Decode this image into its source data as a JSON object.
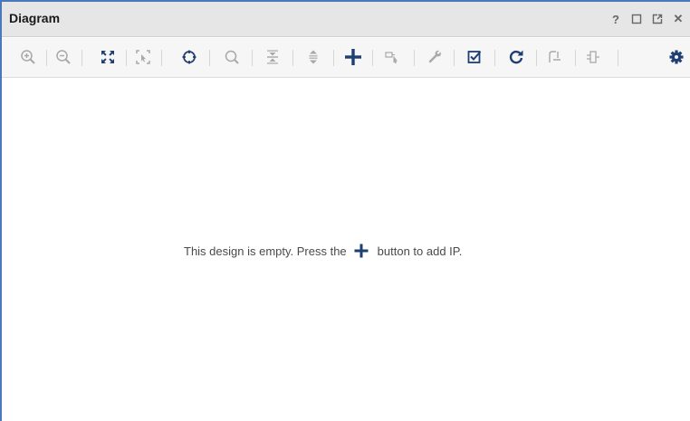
{
  "window": {
    "title": "Diagram",
    "controls": [
      {
        "name": "help",
        "icon": "question-icon",
        "glyph": "?"
      },
      {
        "name": "maximize",
        "icon": "maximize-icon"
      },
      {
        "name": "float",
        "icon": "float-window-icon"
      },
      {
        "name": "close",
        "icon": "close-icon",
        "glyph": "✕"
      }
    ]
  },
  "toolbar": {
    "buttons": [
      {
        "name": "zoom-in",
        "icon": "zoom-in-icon",
        "enabled": false
      },
      {
        "name": "zoom-out",
        "icon": "zoom-out-icon",
        "enabled": false
      },
      {
        "name": "zoom-fit",
        "icon": "zoom-fit-icon",
        "enabled": true
      },
      {
        "name": "zoom-area",
        "icon": "zoom-area-icon",
        "enabled": false
      },
      {
        "name": "auto-center",
        "icon": "crosshair-icon",
        "enabled": true
      },
      {
        "name": "search",
        "icon": "search-icon",
        "enabled": false
      },
      {
        "name": "collapse-all",
        "icon": "collapse-icon",
        "enabled": false
      },
      {
        "name": "expand-all",
        "icon": "expand-icon",
        "enabled": false
      },
      {
        "name": "add-ip",
        "icon": "plus-icon",
        "enabled": true
      },
      {
        "name": "add-module",
        "icon": "add-module-icon",
        "enabled": false
      },
      {
        "name": "properties",
        "icon": "wrench-icon",
        "enabled": false
      },
      {
        "name": "validate-design",
        "icon": "validate-icon",
        "enabled": true
      },
      {
        "name": "regenerate-layout",
        "icon": "refresh-icon",
        "enabled": true
      },
      {
        "name": "run-connection",
        "icon": "connection-icon",
        "enabled": false
      },
      {
        "name": "ports",
        "icon": "port-icon",
        "enabled": false
      },
      {
        "name": "settings",
        "icon": "gear-icon",
        "enabled": true
      }
    ]
  },
  "canvas": {
    "empty_message_before": "This design is empty. Press the",
    "empty_message_after": "button to add IP."
  },
  "colors": {
    "accent": "#1f3e72",
    "border": "#4a78b8",
    "disabled_icon": "#a8a8a8",
    "titlebar_bg": "#e6e6e6"
  }
}
